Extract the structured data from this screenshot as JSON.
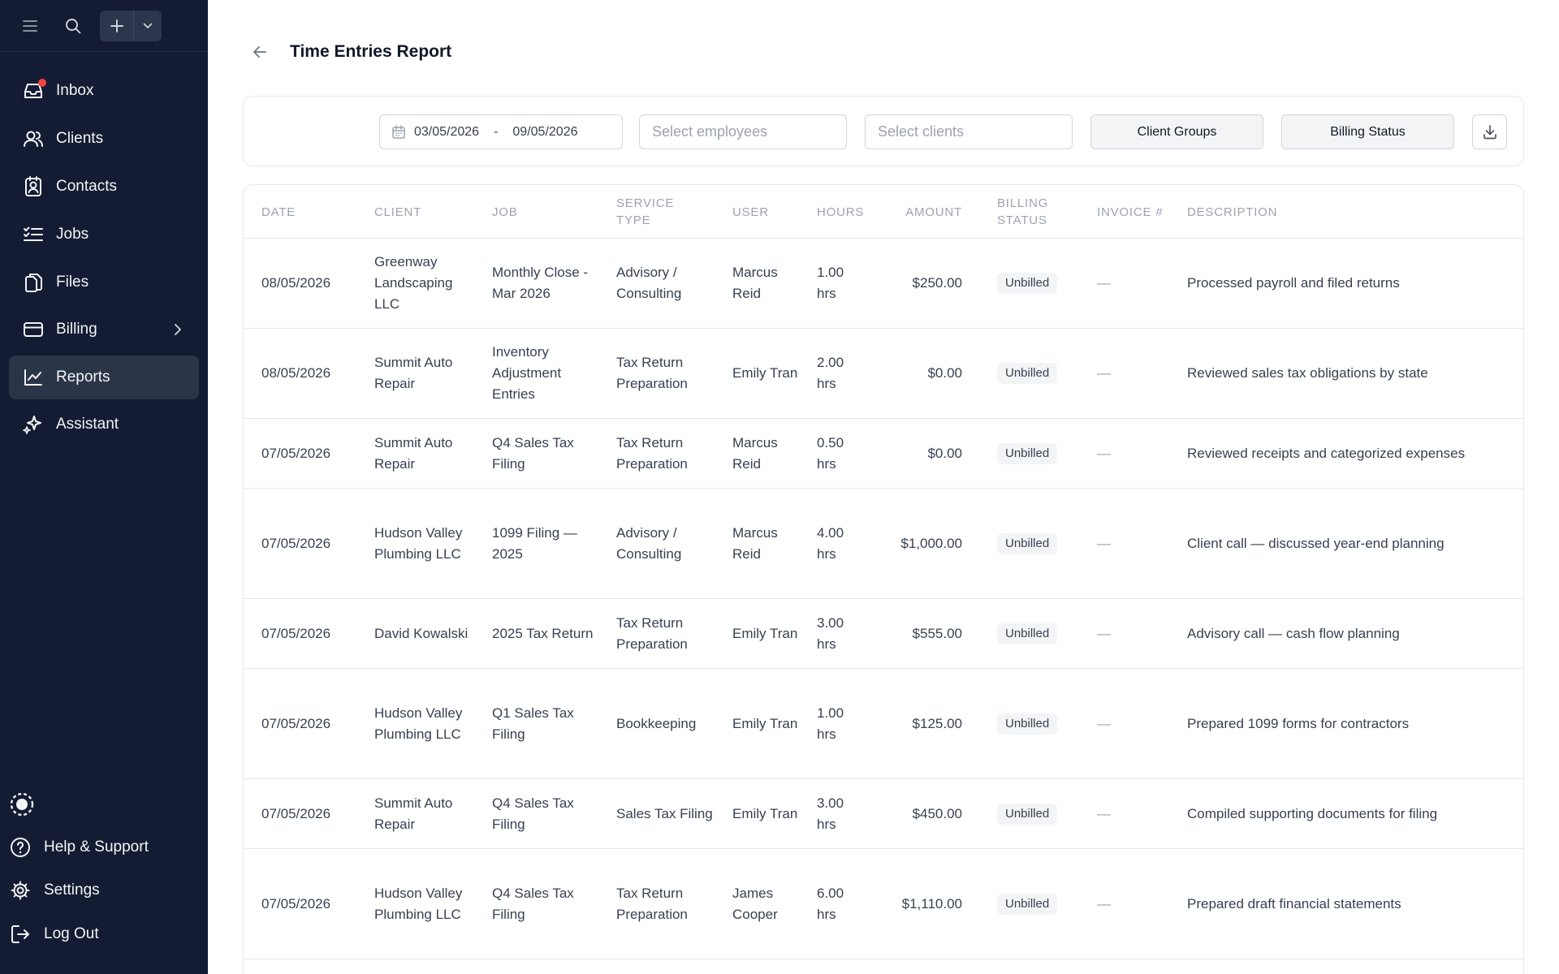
{
  "sidebar": {
    "nav": [
      {
        "label": "Inbox",
        "icon": "inbox-icon",
        "active": false
      },
      {
        "label": "Clients",
        "icon": "users-icon",
        "active": false
      },
      {
        "label": "Contacts",
        "icon": "contacts-icon",
        "active": false
      },
      {
        "label": "Jobs",
        "icon": "list-check-icon",
        "active": false
      },
      {
        "label": "Files",
        "icon": "files-icon",
        "active": false
      },
      {
        "label": "Billing",
        "icon": "card-icon",
        "active": false
      },
      {
        "label": "Reports",
        "icon": "chart-line-icon",
        "active": true
      },
      {
        "label": "Assistant",
        "icon": "sparkles-icon",
        "active": false
      }
    ],
    "bottom": [
      {
        "label": "Help & Support",
        "icon": "help-circle-icon"
      },
      {
        "label": "Settings",
        "icon": "gear-icon"
      },
      {
        "label": "Log Out",
        "icon": "logout-icon"
      }
    ]
  },
  "header": {
    "title": "Time Entries Report"
  },
  "filters": {
    "date_from": "03/05/2026",
    "date_sep": "-",
    "date_to": "09/05/2026",
    "employees_placeholder": "Select employees",
    "clients_placeholder": "Select clients",
    "client_groups_label": "Client Groups",
    "billing_status_label": "Billing Status"
  },
  "table": {
    "columns": [
      "Date",
      "Client",
      "Job",
      "Service Type",
      "User",
      "Hours",
      "Amount",
      "Billing Status",
      "Invoice #",
      "Description"
    ],
    "rows": [
      {
        "date": "08/05/2026",
        "client": "Greenway Landscaping LLC",
        "job": "Monthly Close - Mar 2026",
        "service": "Advisory / Consulting",
        "user": "Marcus Reid",
        "hours": "1.00 hrs",
        "amount": "$250.00",
        "status": "Unbilled",
        "invoice": "—",
        "description": "Processed payroll and filed returns"
      },
      {
        "date": "08/05/2026",
        "client": "Summit Auto Repair",
        "job": "Inventory Adjustment Entries",
        "service": "Tax Return Preparation",
        "user": "Emily Tran",
        "hours": "2.00 hrs",
        "amount": "$0.00",
        "status": "Unbilled",
        "invoice": "—",
        "description": "Reviewed sales tax obligations by state"
      },
      {
        "date": "07/05/2026",
        "client": "Summit Auto Repair",
        "job": "Q4 Sales Tax Filing",
        "service": "Tax Return Preparation",
        "user": "Marcus Reid",
        "hours": "0.50 hrs",
        "amount": "$0.00",
        "status": "Unbilled",
        "invoice": "—",
        "description": "Reviewed receipts and categorized expenses"
      },
      {
        "date": "07/05/2026",
        "client": "Hudson Valley Plumbing LLC",
        "job": "1099 Filing — 2025",
        "service": "Advisory / Consulting",
        "user": "Marcus Reid",
        "hours": "4.00 hrs",
        "amount": "$1,000.00",
        "status": "Unbilled",
        "invoice": "—",
        "description": "Client call — discussed year-end planning"
      },
      {
        "date": "07/05/2026",
        "client": "David Kowalski",
        "job": "2025 Tax Return",
        "service": "Tax Return Preparation",
        "user": "Emily Tran",
        "hours": "3.00 hrs",
        "amount": "$555.00",
        "status": "Unbilled",
        "invoice": "—",
        "description": "Advisory call — cash flow planning"
      },
      {
        "date": "07/05/2026",
        "client": "Hudson Valley Plumbing LLC",
        "job": "Q1 Sales Tax Filing",
        "service": "Bookkeeping",
        "user": "Emily Tran",
        "hours": "1.00 hrs",
        "amount": "$125.00",
        "status": "Unbilled",
        "invoice": "—",
        "description": "Prepared 1099 forms for contractors"
      },
      {
        "date": "07/05/2026",
        "client": "Summit Auto Repair",
        "job": "Q4 Sales Tax Filing",
        "service": "Sales Tax Filing",
        "user": "Emily Tran",
        "hours": "3.00 hrs",
        "amount": "$450.00",
        "status": "Unbilled",
        "invoice": "—",
        "description": "Compiled supporting documents for filing"
      },
      {
        "date": "07/05/2026",
        "client": "Hudson Valley Plumbing LLC",
        "job": "Q4 Sales Tax Filing",
        "service": "Tax Return Preparation",
        "user": "James Cooper",
        "hours": "6.00 hrs",
        "amount": "$1,110.00",
        "status": "Unbilled",
        "invoice": "—",
        "description": "Prepared draft financial statements"
      }
    ]
  },
  "colors": {
    "sidebar_bg": "#131c33",
    "sidebar_active": "#2b3548",
    "notification": "#ef4444"
  }
}
